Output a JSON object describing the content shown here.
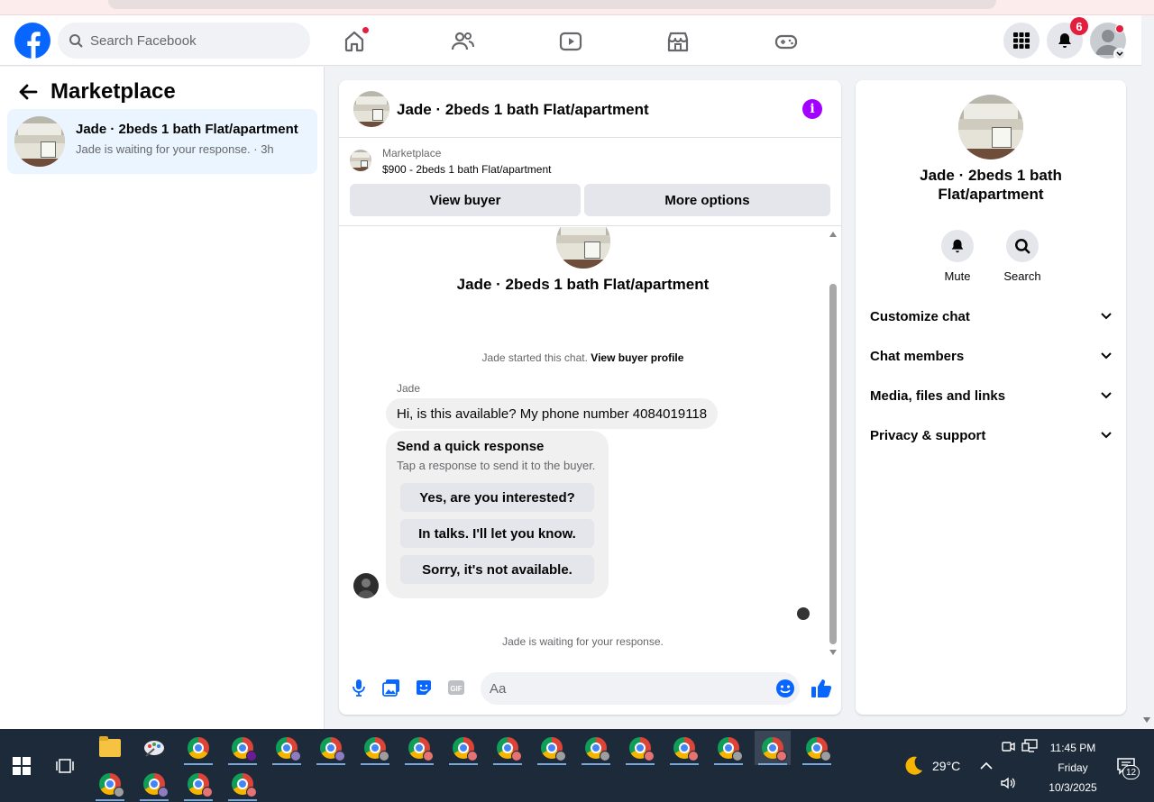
{
  "nav": {
    "search_placeholder": "Search Facebook",
    "notifications_count": "6"
  },
  "sidebar": {
    "title": "Marketplace",
    "chats": [
      {
        "title": "Jade · 2beds 1 bath Flat/apartment",
        "subtitle": "Jade is waiting for your response. · 3h"
      }
    ]
  },
  "chat": {
    "header_title": "Jade · 2beds 1 bath Flat/apartment",
    "listing_label": "Marketplace",
    "listing_price": "$900 - 2beds 1 bath Flat/apartment",
    "view_buyer": "View buyer",
    "more_options": "More options",
    "convo_title": "Jade · 2beds 1 bath Flat/apartment",
    "started_text": "Jade started this chat.",
    "view_buyer_profile": "View buyer profile",
    "sender_name": "Jade",
    "message": "Hi, is this available? My phone number 4084019118",
    "quick_title": "Send a quick response",
    "quick_subtitle": "Tap a response to send it to the buyer.",
    "quick_responses": [
      "Yes, are you interested?",
      "In talks. I'll let you know.",
      "Sorry, it's not available."
    ],
    "waiting_text": "Jade is waiting for your response.",
    "composer_placeholder": "Aa"
  },
  "info": {
    "title": "Jade · 2beds 1 bath Flat/apartment",
    "mute": "Mute",
    "search": "Search",
    "sections": [
      "Customize chat",
      "Chat members",
      "Media, files and links",
      "Privacy & support"
    ]
  },
  "taskbar": {
    "weather_temp": "29°C",
    "time": "11:45 PM",
    "day": "Friday",
    "date": "10/3/2025",
    "notification_count": "12"
  },
  "colors": {
    "brand": "#0866ff",
    "badge": "#e41e3f",
    "info_accent": "#a200ff",
    "selected_row": "#ebf5ff"
  }
}
